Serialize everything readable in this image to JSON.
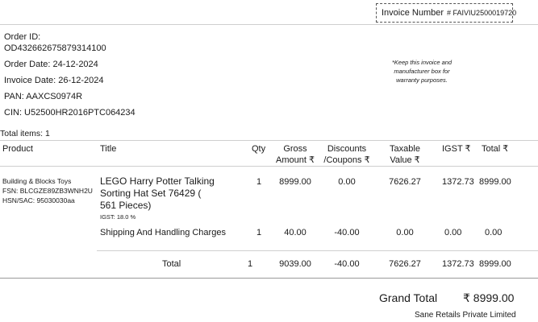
{
  "invoice": {
    "number_label": "Invoice Number",
    "number_value": "# FAIVIU2500019720"
  },
  "order": {
    "id_label": "Order ID:",
    "id_value": "OD432662675879314100",
    "order_date": "Order Date:  24-12-2024",
    "invoice_date": "Invoice Date:  26-12-2024",
    "pan": "PAN:  AAXCS0974R",
    "cin": "CIN:  U52500HR2016PTC064234"
  },
  "note": {
    "line1": "*Keep this invoice and",
    "line2": "manufacturer box for",
    "line3": "warranty purposes."
  },
  "total_items": "Total items: 1",
  "table": {
    "headers": {
      "product": "Product",
      "title": "Title",
      "qty": "Qty",
      "gross_1": "Gross",
      "gross_2": "Amount ₹",
      "disc_1": "Discounts",
      "disc_2": "/Coupons ₹",
      "taxable_1": "Taxable",
      "taxable_2": "Value ₹",
      "igst": "IGST ₹",
      "total": "Total ₹"
    },
    "item": {
      "category": "Building & Blocks Toys",
      "fsn": "FSN: BLCGZE89ZB3WNH2U",
      "hsn": "HSN/SAC: 95030030aa",
      "title_1": "LEGO Harry Potter Talking",
      "title_2": "Sorting Hat Set 76429 (",
      "title_3": "561 Pieces)",
      "igst_rate": "IGST:  18.0 %",
      "qty": "1",
      "gross": "8999.00",
      "discount": "0.00",
      "taxable": "7626.27",
      "igst": "1372.73",
      "total": "8999.00"
    },
    "shipping": {
      "title": "Shipping And Handling Charges",
      "qty": "1",
      "gross": "40.00",
      "discount": "-40.00",
      "taxable": "0.00",
      "igst": "0.00",
      "total": "0.00"
    },
    "totals": {
      "label": "Total",
      "qty": "1",
      "gross": "9039.00",
      "discount": "-40.00",
      "taxable": "7626.27",
      "igst": "1372.73",
      "total": "8999.00"
    }
  },
  "grand_total": {
    "label": "Grand Total",
    "value": "₹ 8999.00"
  },
  "seller": "Sane Retails Private Limited"
}
